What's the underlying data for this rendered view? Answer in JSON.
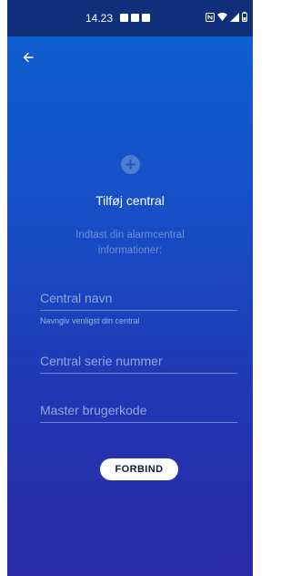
{
  "status_bar": {
    "time": "14.23",
    "left_icons": [
      "notification-square-icon",
      "notification-square-icon",
      "gallery-icon"
    ],
    "right_icons": [
      "nfc-icon",
      "wifi-icon",
      "signal-icon",
      "battery-icon"
    ]
  },
  "header": {
    "back_icon": "arrow-left-icon"
  },
  "main": {
    "add_icon": "plus-circle-icon",
    "title": "Tilføj central",
    "subtitle": "Indtast din alarmcentral informationer:",
    "fields": {
      "central_name": {
        "placeholder": "Central navn",
        "value": "",
        "helper": "Navngiv venligst din central"
      },
      "serial_number": {
        "placeholder": "Central serie nummer",
        "value": ""
      },
      "master_code": {
        "placeholder": "Master brugerkode",
        "value": ""
      }
    },
    "connect_button": "FORBIND"
  },
  "colors": {
    "gradient_top": "#0e61cf",
    "gradient_bottom": "#2a2aa6",
    "status_bar": "#0f2f7a",
    "accent_circle": "#4b7fd2",
    "button_bg": "#ffffff"
  }
}
